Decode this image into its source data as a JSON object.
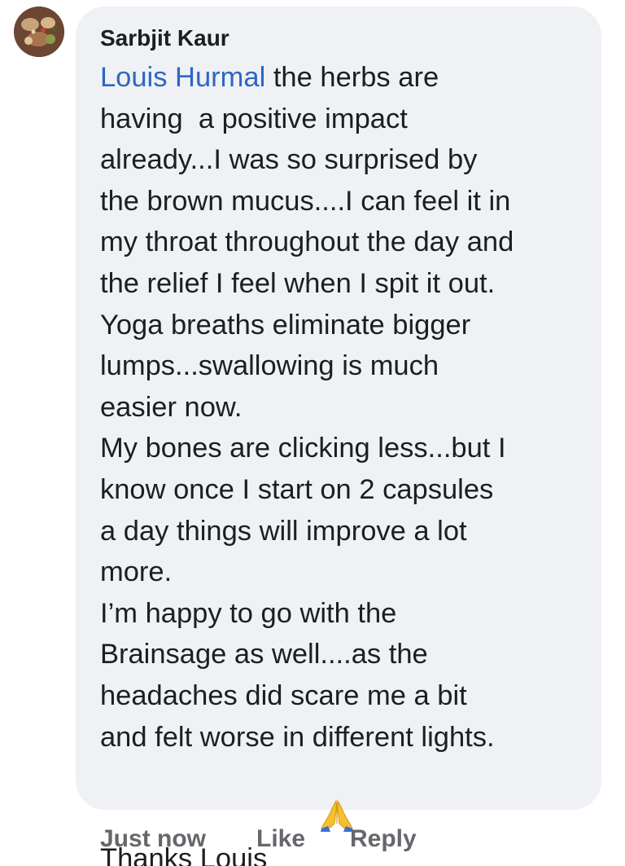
{
  "comment": {
    "author": "Sarbjit Kaur",
    "mention": "Louis Hurmal",
    "lines": [
      " the herbs are",
      "having  a positive impact",
      "already...I was so surprised by",
      "the brown mucus....I can feel it in",
      "my throat throughout the day and",
      "the relief I feel when I spit it out.",
      "Yoga breaths eliminate bigger",
      "lumps...swallowing is much",
      "easier now.",
      "My bones are clicking less...but I",
      "know once I start on 2 capsules",
      "a day things will improve a lot",
      "more.",
      "I’m happy to go with the",
      "Brainsage as well....as the",
      "headaches did scare me a bit",
      "and felt worse in different lights.",
      "Thanks Louis"
    ],
    "emoji": "folded-hands-icon",
    "timestamp": "Just now",
    "like_label": "Like",
    "reply_label": "Reply"
  },
  "colors": {
    "bubble": "#eff1f5",
    "mention": "#2d67c2",
    "text": "#1c1e21",
    "meta": "#65676b"
  }
}
